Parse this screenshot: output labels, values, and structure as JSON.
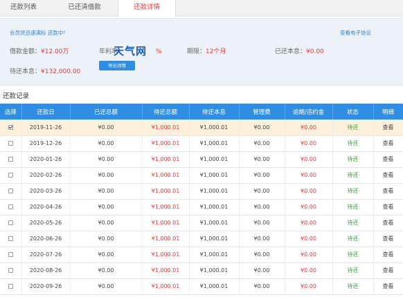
{
  "tabs": [
    {
      "label": "还款列表"
    },
    {
      "label": "已还清借款"
    },
    {
      "label": "还款详情"
    }
  ],
  "info": {
    "notice": "会员贷迅速满标 还款中!",
    "agreement_link": "查看电子协议",
    "loan_amount_label": "借款金额：",
    "loan_amount_value": "¥12.00万",
    "rate_label": "年利率：",
    "rate_value": "%",
    "term_label": "期限：",
    "term_value": "12个月",
    "repaid_principal_label": "已还本息：",
    "repaid_principal_value": "¥0.00",
    "pending_label": "待还本息：",
    "pending_value": "¥132,000.00",
    "export_button": "导出详情",
    "watermark": "天气网"
  },
  "section_title": "还款记录",
  "table": {
    "headers": [
      "选择",
      "还款日",
      "已还总额",
      "待还总额",
      "待还本息",
      "管理费",
      "逾期/违约金",
      "状态",
      "明细"
    ],
    "rows": [
      {
        "checked": true,
        "date": "2019-11-26",
        "repaid": "¥0.00",
        "pending_total": "¥1,000.01",
        "pending_principal": "¥1,000.01",
        "fee": "¥0.00",
        "penalty": "¥0.00",
        "status": "待还",
        "detail": "查看"
      },
      {
        "checked": false,
        "date": "2019-12-26",
        "repaid": "¥0.00",
        "pending_total": "¥1,000.01",
        "pending_principal": "¥1,000.01",
        "fee": "¥0.00",
        "penalty": "¥0.00",
        "status": "待还",
        "detail": "查看"
      },
      {
        "checked": false,
        "date": "2020-01-26",
        "repaid": "¥0.00",
        "pending_total": "¥1,000.01",
        "pending_principal": "¥1,000.01",
        "fee": "¥0.00",
        "penalty": "¥0.00",
        "status": "待还",
        "detail": "查看"
      },
      {
        "checked": false,
        "date": "2020-02-26",
        "repaid": "¥0.00",
        "pending_total": "¥1,000.01",
        "pending_principal": "¥1,000.01",
        "fee": "¥0.00",
        "penalty": "¥0.00",
        "status": "待还",
        "detail": "查看"
      },
      {
        "checked": false,
        "date": "2020-03-26",
        "repaid": "¥0.00",
        "pending_total": "¥1,000.01",
        "pending_principal": "¥1,000.01",
        "fee": "¥0.00",
        "penalty": "¥0.00",
        "status": "待还",
        "detail": "查看"
      },
      {
        "checked": false,
        "date": "2020-04-26",
        "repaid": "¥0.00",
        "pending_total": "¥1,000.01",
        "pending_principal": "¥1,000.01",
        "fee": "¥0.00",
        "penalty": "¥0.00",
        "status": "待还",
        "detail": "查看"
      },
      {
        "checked": false,
        "date": "2020-05-26",
        "repaid": "¥0.00",
        "pending_total": "¥1,000.01",
        "pending_principal": "¥1,000.01",
        "fee": "¥0.00",
        "penalty": "¥0.00",
        "status": "待还",
        "detail": "查看"
      },
      {
        "checked": false,
        "date": "2020-06-26",
        "repaid": "¥0.00",
        "pending_total": "¥1,000.01",
        "pending_principal": "¥1,000.01",
        "fee": "¥0.00",
        "penalty": "¥0.00",
        "status": "待还",
        "detail": "查看"
      },
      {
        "checked": false,
        "date": "2020-07-26",
        "repaid": "¥0.00",
        "pending_total": "¥1,000.01",
        "pending_principal": "¥1,000.01",
        "fee": "¥0.00",
        "penalty": "¥0.00",
        "status": "待还",
        "detail": "查看"
      },
      {
        "checked": false,
        "date": "2020-08-26",
        "repaid": "¥0.00",
        "pending_total": "¥1,000.01",
        "pending_principal": "¥1,000.01",
        "fee": "¥0.00",
        "penalty": "¥0.00",
        "status": "待还",
        "detail": "查看"
      },
      {
        "checked": false,
        "date": "2020-09-26",
        "repaid": "¥0.00",
        "pending_total": "¥1,000.01",
        "pending_principal": "¥1,000.01",
        "fee": "¥0.00",
        "penalty": "¥0.00",
        "status": "待还",
        "detail": "查看"
      }
    ]
  },
  "colors": {
    "accent": "#2f8de4",
    "amount_red": "#e4393c",
    "status_green": "#3a9b3a",
    "selected_row": "#fdf1dc"
  }
}
